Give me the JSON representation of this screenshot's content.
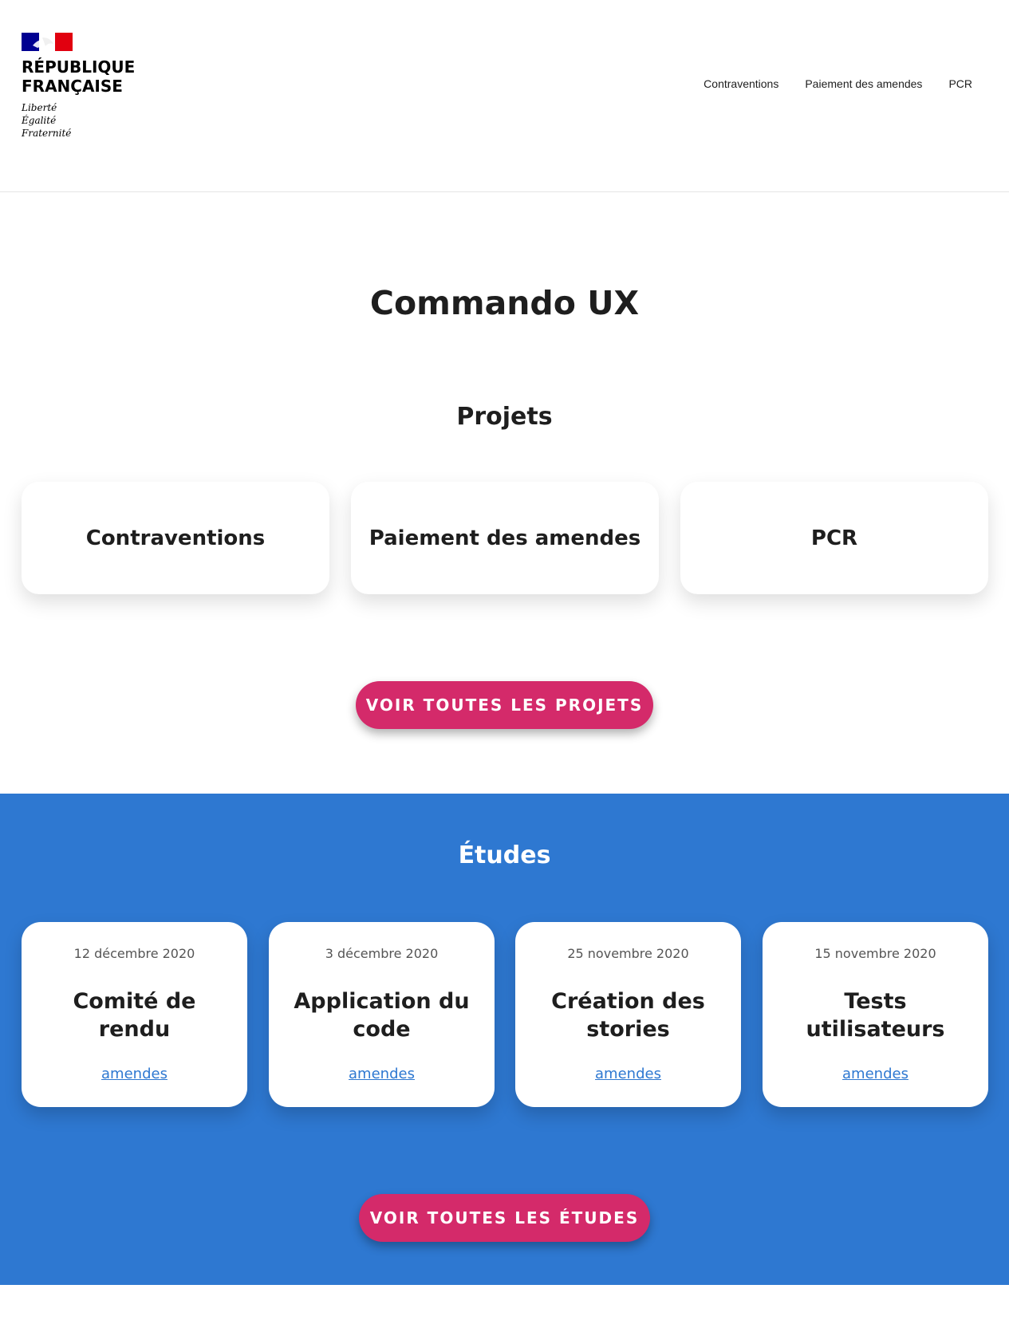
{
  "header": {
    "logo": {
      "name_line1": "RÉPUBLIQUE",
      "name_line2": "FRANÇAISE",
      "motto": [
        "Liberté",
        "Égalité",
        "Fraternité"
      ],
      "flag_colors": {
        "blue": "#000091",
        "white": "#ffffff",
        "red": "#e1000f"
      }
    },
    "nav": [
      "Contraventions",
      "Paiement des amendes",
      "PCR"
    ]
  },
  "page_title": "Commando UX",
  "projets": {
    "title": "Projets",
    "cards": [
      "Contraventions",
      "Paiement des amendes",
      "PCR"
    ],
    "button_label": "VOIR TOUTES LES PROJETS"
  },
  "etudes": {
    "title": "Études",
    "cards": [
      {
        "date": "12 décembre 2020",
        "title": "Comité de rendu",
        "tag": "amendes"
      },
      {
        "date": "3 décembre 2020",
        "title": "Application du code",
        "tag": "amendes"
      },
      {
        "date": "25 novembre 2020",
        "title": "Création des stories",
        "tag": "amendes"
      },
      {
        "date": "15 novembre 2020",
        "title": "Tests utilisateurs",
        "tag": "amendes"
      }
    ],
    "button_label": "VOIR TOUTES LES ÉTUDES"
  },
  "colors": {
    "accent_button": "#d42a6a",
    "etudes_background": "#2e78d1",
    "link": "#2e78d1",
    "text": "#1e1e1e"
  }
}
